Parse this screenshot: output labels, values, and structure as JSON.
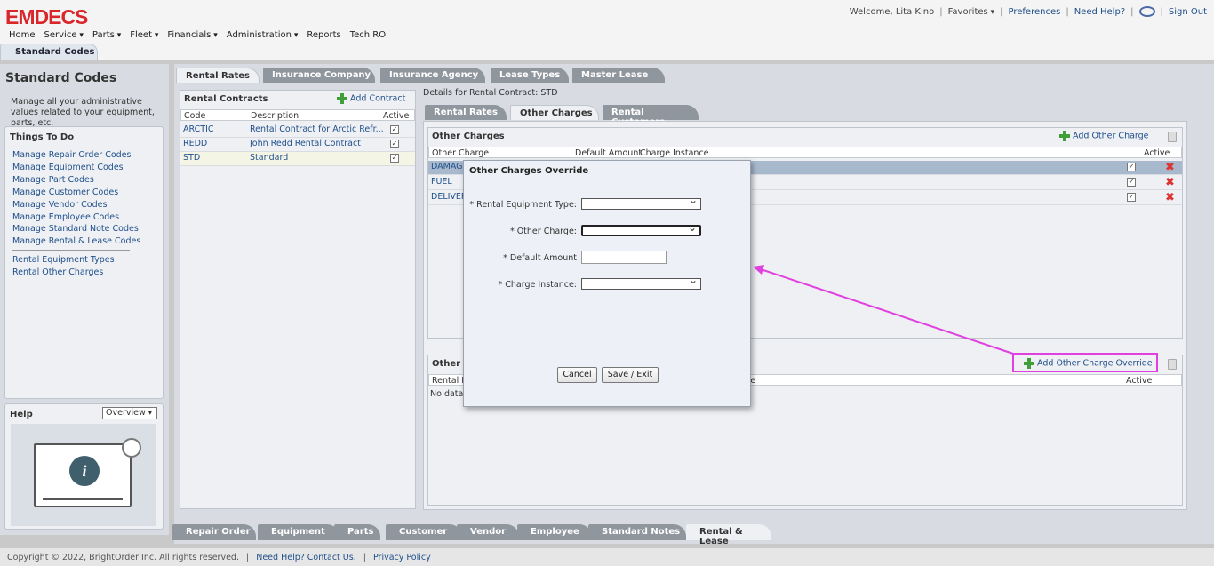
{
  "header": {
    "logo": "EMDECS",
    "welcome": "Welcome, Lita Kino",
    "favorites": "Favorites",
    "preferences": "Preferences",
    "need_help": "Need Help?",
    "sign_out": "Sign Out",
    "nav": [
      "Home",
      "Service",
      "Parts",
      "Fleet",
      "Financials",
      "Administration",
      "Reports",
      "Tech RO"
    ],
    "page_tab": "Standard Codes"
  },
  "sidebar": {
    "title": "Standard Codes",
    "description": "Manage all your administrative values related to your equipment, parts, etc.",
    "todo_title": "Things To Do",
    "todo_items": [
      "Manage Repair Order Codes",
      "Manage Equipment Codes",
      "Manage Part Codes",
      "Manage Customer Codes",
      "Manage Vendor Codes",
      "Manage Employee Codes",
      "Manage Standard Note Codes",
      "Manage Rental & Lease Codes"
    ],
    "rental_items": [
      "Rental Equipment Types",
      "Rental Other Charges"
    ],
    "help_title": "Help",
    "help_select": "Overview",
    "help_icon_letter": "i"
  },
  "top_tabs": [
    "Rental Rates",
    "Insurance Company",
    "Insurance Agency",
    "Lease Types",
    "Master Lease"
  ],
  "contracts": {
    "title": "Rental Contracts",
    "add_label": "Add Contract",
    "columns": [
      "Code",
      "Description",
      "Active"
    ],
    "rows": [
      {
        "code": "ARCTIC",
        "description": "Rental Contract for Arctic Refr..."
      },
      {
        "code": "REDD",
        "description": "John Redd Rental Contract"
      },
      {
        "code": "STD",
        "description": "Standard"
      }
    ]
  },
  "details": {
    "label": "Details for Rental Contract: STD",
    "tabs": [
      "Rental Rates",
      "Other Charges",
      "Rental Customers"
    ],
    "other_charges": {
      "title": "Other Charges",
      "add_label": "Add Other Charge",
      "columns": [
        "Other Charge",
        "Default Amount",
        "Charge Instance",
        "Active"
      ],
      "rows": [
        "DAMAGE",
        "FUEL",
        "DELIVERY"
      ]
    },
    "override": {
      "title": "Other C",
      "add_label": "Add Other Charge Override",
      "col_left": "Rental E",
      "col_right": "nce",
      "active": "Active",
      "no_data": "No data"
    }
  },
  "bottom_tabs": [
    "Repair Order",
    "Equipment",
    "Parts",
    "Customer",
    "Vendor",
    "Employee",
    "Standard Notes",
    "Rental & Lease"
  ],
  "footer": {
    "copyright": "Copyright © 2022, BrightOrder Inc. All rights reserved.",
    "contact": "Need Help? Contact Us.",
    "privacy": "Privacy Policy"
  },
  "modal": {
    "title": "Other Charges Override",
    "fields": {
      "equipment_type": "* Rental Equipment Type:",
      "other_charge": "* Other Charge:",
      "default_amount": "* Default Amount",
      "charge_instance": "* Charge Instance:"
    },
    "cancel": "Cancel",
    "save": "Save / Exit"
  },
  "colors": {
    "brand": "#d9262b",
    "link": "#1f4f8b",
    "highlight": "#e040e0"
  }
}
